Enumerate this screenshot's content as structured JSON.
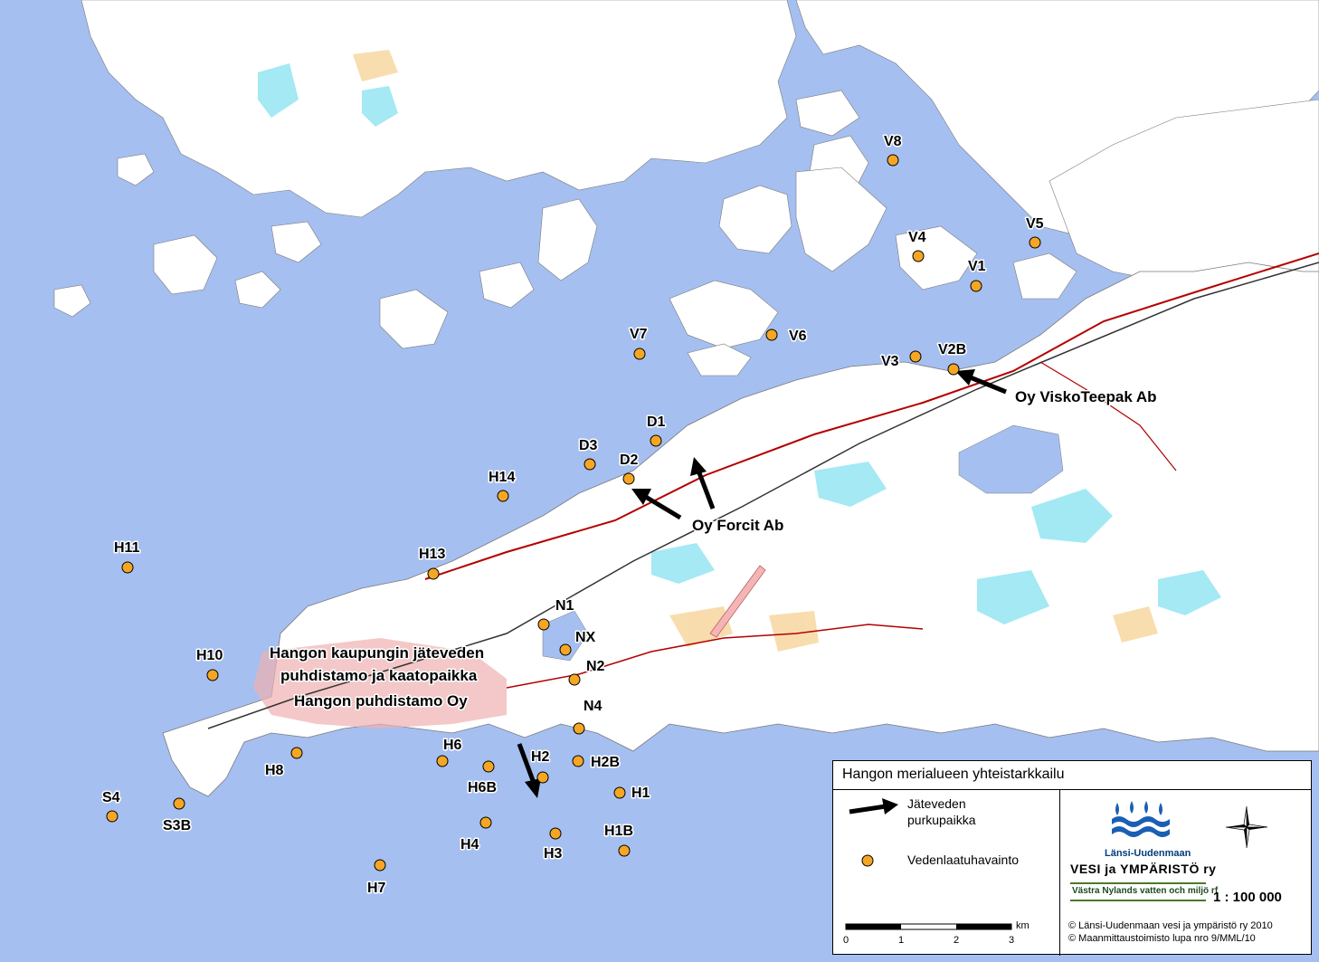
{
  "colors": {
    "sea": "#a5bff0",
    "land": "#ffffff",
    "marker": "#f5a623",
    "road": "#b40000",
    "arrow": "#000000"
  },
  "stations": [
    {
      "label": "V8"
    },
    {
      "label": "V4"
    },
    {
      "label": "V5"
    },
    {
      "label": "V1"
    },
    {
      "label": "V6"
    },
    {
      "label": "V7"
    },
    {
      "label": "V3"
    },
    {
      "label": "V2B"
    },
    {
      "label": "D1"
    },
    {
      "label": "D3"
    },
    {
      "label": "D2"
    },
    {
      "label": "H14"
    },
    {
      "label": "H11"
    },
    {
      "label": "H13"
    },
    {
      "label": "N1"
    },
    {
      "label": "NX"
    },
    {
      "label": "N2"
    },
    {
      "label": "N4"
    },
    {
      "label": "H10"
    },
    {
      "label": "H6"
    },
    {
      "label": "H2"
    },
    {
      "label": "H2B"
    },
    {
      "label": "H8"
    },
    {
      "label": "H6B"
    },
    {
      "label": "H1"
    },
    {
      "label": "S4"
    },
    {
      "label": "S3B"
    },
    {
      "label": "H4"
    },
    {
      "label": "H3"
    },
    {
      "label": "H1B"
    },
    {
      "label": "H7"
    }
  ],
  "discharge_labels": {
    "viskoteepak": "Oy ViskoTeepak Ab",
    "forcit": "Oy Forcit Ab",
    "kaupunki_line1": "Hangon kaupungin jäteveden",
    "kaupunki_line2": "puhdistamo ja kaatopaikka",
    "puhdistamo": "Hangon puhdistamo Oy"
  },
  "legend": {
    "title": "Hangon merialueen yhteistarkkailu",
    "discharge_line1": "Jäteveden",
    "discharge_line2": "purkupaikka",
    "observation": "Vedenlaatuhavainto",
    "scale_unit": "km",
    "scale_ticks": [
      "0",
      "1",
      "2",
      "3"
    ],
    "scale_ratio": "1 : 100 000",
    "logo_line1": "Länsi-Uudenmaan",
    "logo_line2": "VESI ja YMPÄRISTÖ ry",
    "logo_line3": "Västra Nylands vatten och miljö rf",
    "copyright1": "© Länsi-Uudenmaan vesi ja ympäristö ry 2010",
    "copyright2": "© Maanmittaustoimisto lupa nro 9/MML/10"
  }
}
